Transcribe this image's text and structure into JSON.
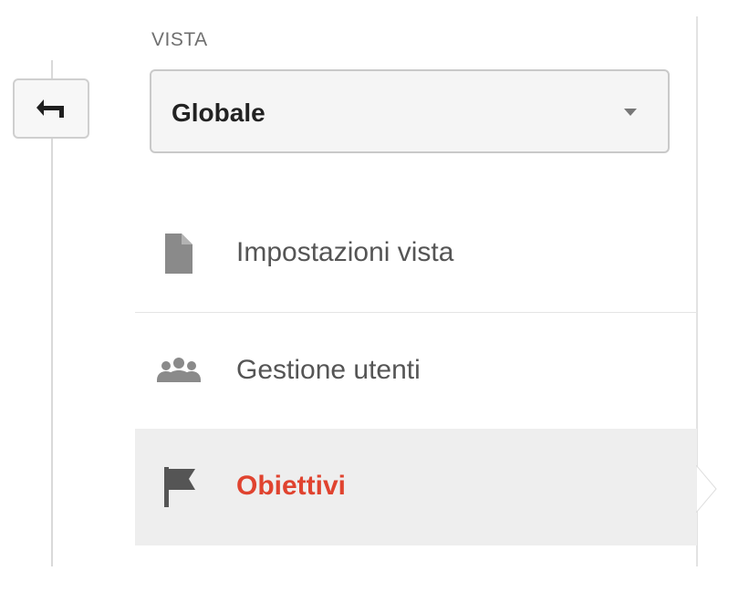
{
  "view_selector": {
    "label": "VISTA",
    "selected_value": "Globale"
  },
  "menu": {
    "items": [
      {
        "label": "Impostazioni vista",
        "icon": "document-icon",
        "active": false
      },
      {
        "label": "Gestione utenti",
        "icon": "users-icon",
        "active": false
      },
      {
        "label": "Obiettivi",
        "icon": "flag-icon",
        "active": true
      }
    ]
  },
  "colors": {
    "active_text": "#e0432f",
    "active_background": "#eeeeee",
    "icon_gray": "#757575"
  },
  "back_button": {
    "icon": "back-arrow-icon"
  }
}
